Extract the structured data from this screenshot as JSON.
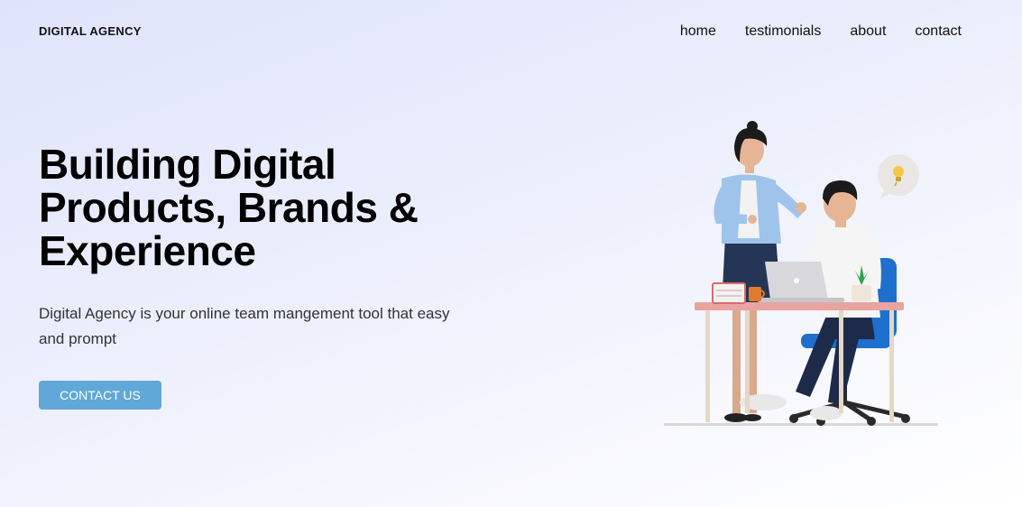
{
  "navbar": {
    "brand": "DIGITAL AGENCY",
    "links": [
      {
        "label": "home"
      },
      {
        "label": "testimonials"
      },
      {
        "label": "about"
      },
      {
        "label": "contact"
      }
    ]
  },
  "hero": {
    "headline_lines": [
      "Building Digital",
      "Products, Brands &",
      "Experience"
    ],
    "description": "Digital Agency is your online team mangement tool that easy and prompt",
    "cta_label": "CONTACT US",
    "illustration_icon": "team-at-desk-illustration"
  },
  "colors": {
    "accent": "#5fa8d8",
    "background_start": "#dfe4fb",
    "background_end": "#ffffff"
  }
}
